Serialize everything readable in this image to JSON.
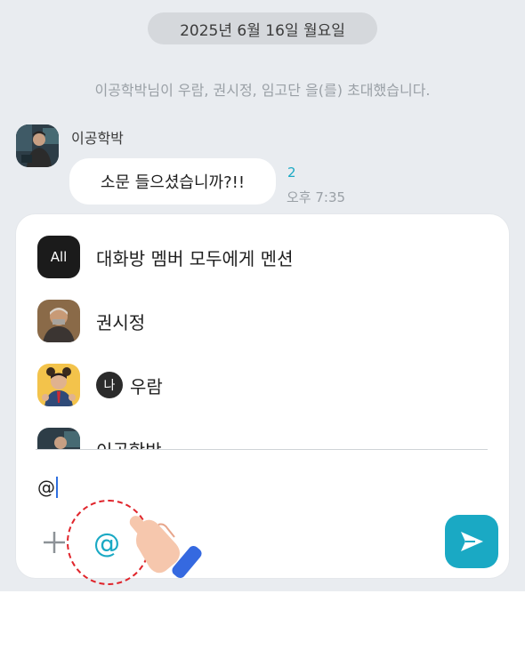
{
  "chat": {
    "date_divider": "2025년 6월 16일 월요일",
    "system_message": "이공학박님이 우람, 권시정, 임고단 을(를) 초대했습니다.",
    "message": {
      "sender": "이공학박",
      "text": "소문 들으셨습니까?!!",
      "unread_count": "2",
      "time": "오후 7:35"
    }
  },
  "mention_panel": {
    "items": [
      {
        "avatar_text": "All",
        "label": "대화방 멤버 모두에게 멘션"
      },
      {
        "label": "권시정"
      },
      {
        "badge": "나",
        "label": "우람"
      },
      {
        "label": "이공학박"
      }
    ]
  },
  "composer": {
    "input_value": "@",
    "mention_button_symbol": "@",
    "accent_color": "#1aa9c4"
  },
  "icons": {
    "plus": "plus-icon",
    "mention": "at-sign-icon",
    "send": "send-icon",
    "hand": "hand-pointer-icon"
  }
}
